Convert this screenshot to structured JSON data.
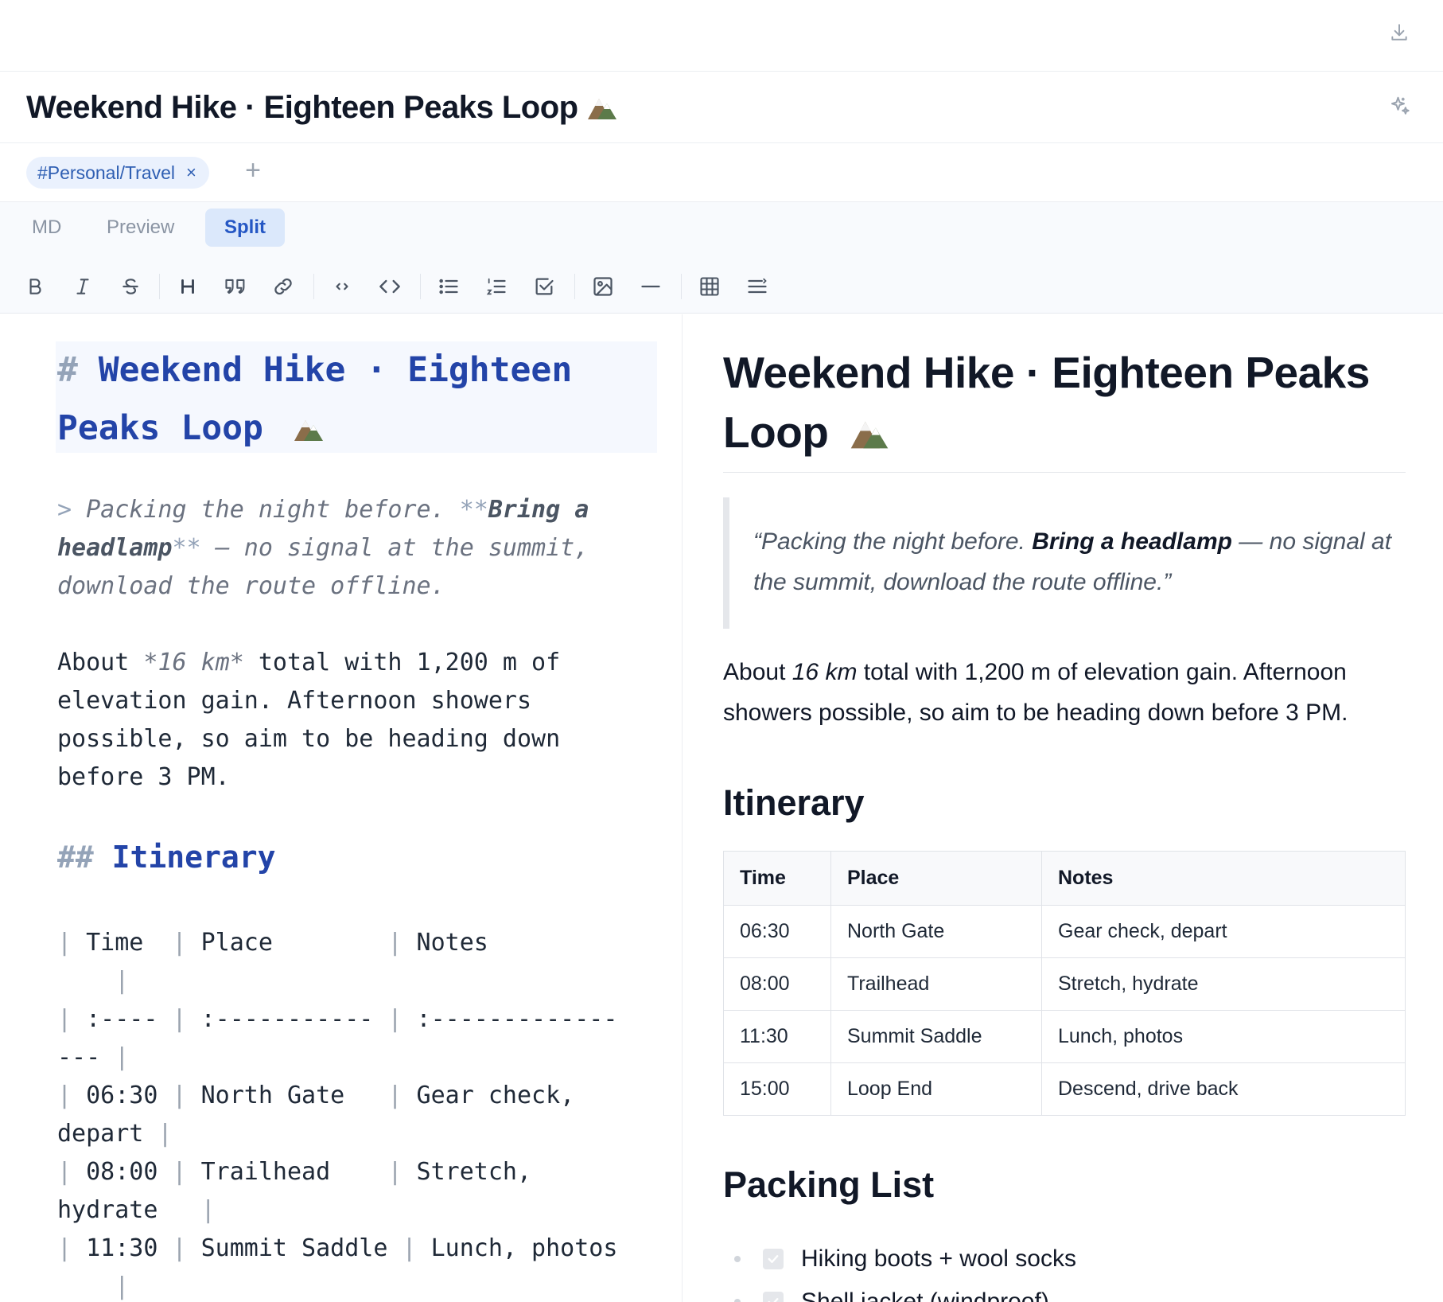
{
  "header": {
    "title": "Weekend Hike · Eighteen Peaks Loop",
    "title_icon": "mountain-icon"
  },
  "tags": {
    "items": [
      "#Personal/Travel"
    ],
    "remove_glyph": "×",
    "add_glyph": "+"
  },
  "modes": {
    "md": "MD",
    "preview": "Preview",
    "split": "Split",
    "active": "Split"
  },
  "toolbar": {
    "buttons": [
      "bold",
      "italic",
      "strikethrough",
      "heading",
      "quote",
      "link",
      "inline-code",
      "code-block",
      "bullet-list",
      "numbered-list",
      "task-list",
      "image",
      "horizontal-rule",
      "table",
      "toc"
    ]
  },
  "editor": {
    "h1_mark": "#",
    "h1_text": "Weekend Hike · Eighteen Peaks Loop",
    "quote_mark": ">",
    "quote_pre": "Packing the night before.",
    "bold_mark": "**",
    "quote_bold": "Bring a headlamp",
    "quote_post": "— no signal at the summit, download the route offline.",
    "para_pre": "About",
    "em_mark": "*",
    "para_em": "16 km",
    "para_post": "total with 1,200 m of elevation gain. Afternoon showers possible, so aim to be heading down before 3 PM.",
    "h2_mark": "##",
    "h2_text": "Itinerary",
    "table_lines": [
      "| Time  | Place        | Notes",
      "    |",
      "| :---- | :----------- | :-------------",
      "--- |",
      "| 06:30 | North Gate   | Gear check,",
      "depart |",
      "| 08:00 | Trailhead    | Stretch,",
      "hydrate   |",
      "| 11:30 | Summit Saddle | Lunch, photos",
      "    |"
    ]
  },
  "preview": {
    "h1": "Weekend Hike · Eighteen Peaks Loop",
    "quote_open": "“",
    "quote_pre": "Packing the night before.",
    "quote_bold": "Bring a headlamp",
    "quote_post": "— no signal at the summit, download the route offline.",
    "quote_close": "”",
    "para_pre": "About",
    "para_em": "16 km",
    "para_post": "total with 1,200 m of elevation gain. Afternoon showers possible, so aim to be heading down before 3 PM.",
    "h2_itinerary": "Itinerary",
    "table": {
      "headers": [
        "Time",
        "Place",
        "Notes"
      ],
      "rows": [
        [
          "06:30",
          "North Gate",
          "Gear check, depart"
        ],
        [
          "08:00",
          "Trailhead",
          "Stretch, hydrate"
        ],
        [
          "11:30",
          "Summit Saddle",
          "Lunch, photos"
        ],
        [
          "15:00",
          "Loop End",
          "Descend, drive back"
        ]
      ]
    },
    "h2_packing": "Packing List",
    "packing": [
      {
        "label": "Hiking boots + wool socks",
        "checked": true
      },
      {
        "label": "Shell jacket (windproof)",
        "checked": true
      }
    ]
  },
  "colors": {
    "accent": "#2557c4",
    "heading_blue": "#2344a8",
    "tag_bg": "#eaf1fd"
  }
}
